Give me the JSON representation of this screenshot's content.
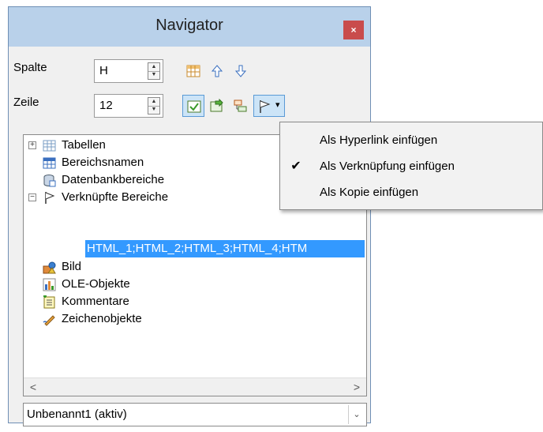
{
  "window": {
    "title": "Navigator",
    "close_glyph": "×"
  },
  "controls": {
    "column_label": "Spalte",
    "column_value": "H",
    "row_label": "Zeile",
    "row_value": "12"
  },
  "toolbar": {
    "icons": [
      "data-range-icon",
      "arrow-up-icon",
      "arrow-down-icon",
      "toggle-content-icon",
      "scenarios-icon",
      "headings-icon",
      "drag-mode-flag-icon",
      "dropdown-arrow-icon"
    ],
    "dropdown_glyph": "▾"
  },
  "tree": {
    "items": [
      {
        "label": "Tabellen",
        "expander": "+"
      },
      {
        "label": "Bereichsnamen",
        "expander": ""
      },
      {
        "label": "Datenbankbereiche",
        "expander": ""
      },
      {
        "label": "Verknüpfte Bereiche",
        "expander": "−"
      },
      {
        "label": "HTML_1;HTML_2;HTML_3;HTML_4;HTM",
        "expander": ""
      },
      {
        "label": "Bild",
        "expander": ""
      },
      {
        "label": "OLE-Objekte",
        "expander": ""
      },
      {
        "label": "Kommentare",
        "expander": ""
      },
      {
        "label": "Zeichenobjekte",
        "expander": ""
      }
    ],
    "scroll_left": "<",
    "scroll_right": ">"
  },
  "document_select": {
    "value": "Unbenannt1 (aktiv)",
    "arrow": "⌄"
  },
  "menu": {
    "items": [
      {
        "label": "Als Hyperlink einfügen",
        "check": ""
      },
      {
        "label": "Als Verknüpfung einfügen",
        "check": "✔"
      },
      {
        "label": "Als Kopie einfügen",
        "check": ""
      }
    ]
  },
  "colors": {
    "titlebar": "#b9d1ea",
    "selection": "#3399ff",
    "close": "#c94c4c"
  }
}
